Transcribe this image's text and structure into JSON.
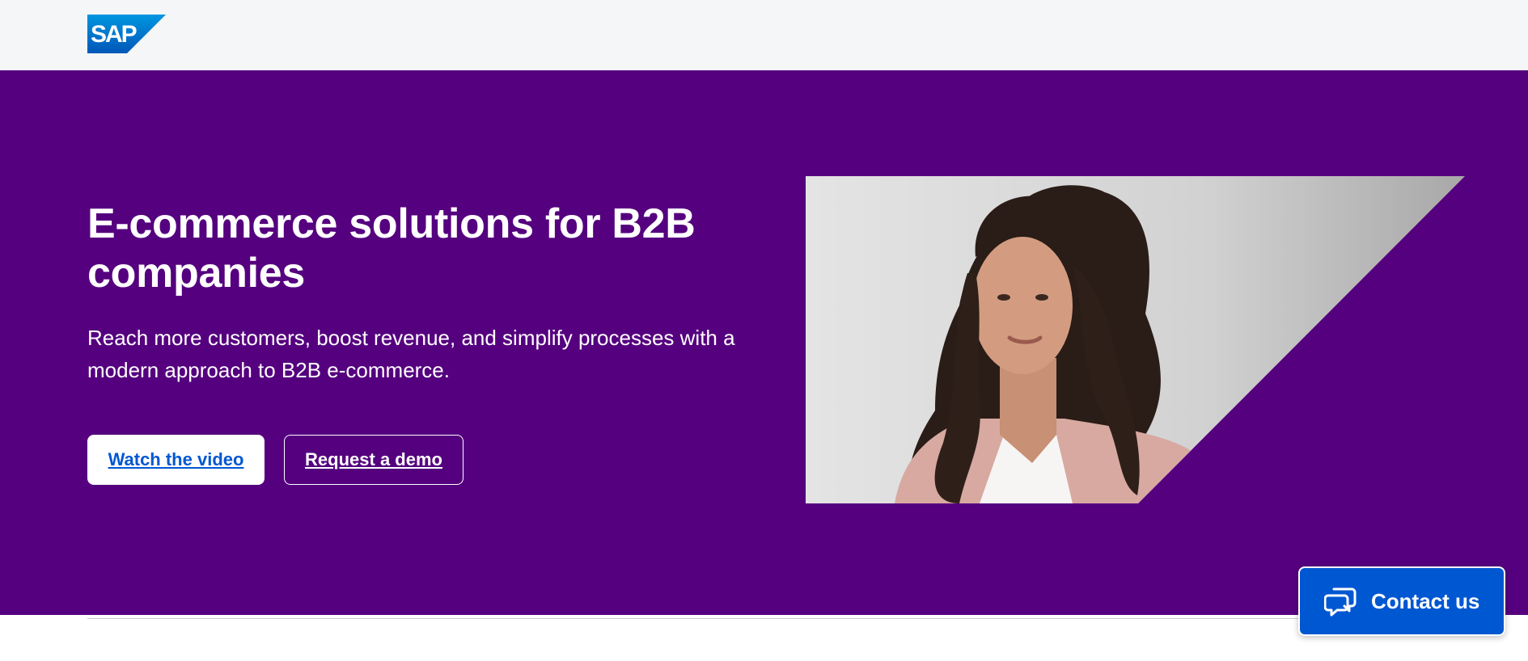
{
  "header": {
    "logo_text": "SAP"
  },
  "hero": {
    "title": "E-commerce solutions for B2B companies",
    "subtitle": "Reach more customers, boost revenue, and simplify processes with a modern approach to B2B e-commerce.",
    "primary_button": "Watch the video",
    "secondary_button": "Request a demo",
    "image_icon": "portrait-photo"
  },
  "contact": {
    "label": "Contact us",
    "icon": "chat-bubbles-icon"
  },
  "colors": {
    "hero_bg": "#55007f",
    "header_bg": "#f5f6f7",
    "primary_blue": "#0057d2",
    "logo_gradient_start": "#0096e0",
    "logo_gradient_end": "#0057b8"
  }
}
